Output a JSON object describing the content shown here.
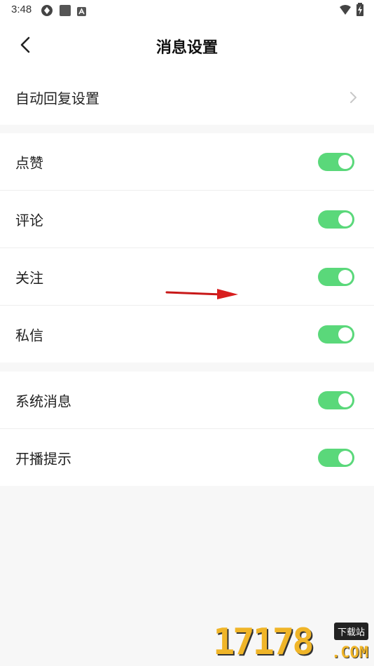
{
  "status_bar": {
    "time": "3:48",
    "icons": [
      "sync-icon",
      "app-square-icon",
      "notification-a-icon",
      "wifi-icon",
      "battery-charging-icon"
    ]
  },
  "header": {
    "title": "消息设置",
    "back_icon": "chevron-left-icon"
  },
  "auto_reply": {
    "label": "自动回复设置",
    "icon": "chevron-right-icon"
  },
  "interaction_section": {
    "items": [
      {
        "label": "点赞",
        "enabled": true
      },
      {
        "label": "评论",
        "enabled": true
      },
      {
        "label": "关注",
        "enabled": true
      },
      {
        "label": "私信",
        "enabled": true
      }
    ]
  },
  "system_section": {
    "items": [
      {
        "label": "系统消息",
        "enabled": true
      },
      {
        "label": "开播提示",
        "enabled": true
      }
    ]
  },
  "colors": {
    "toggle_on": "#5ad87a",
    "background": "#f7f7f7",
    "annotation_arrow": "#e02020"
  },
  "watermark": {
    "digits": "17178",
    "badge": "下载站",
    "domain": ".COM"
  }
}
